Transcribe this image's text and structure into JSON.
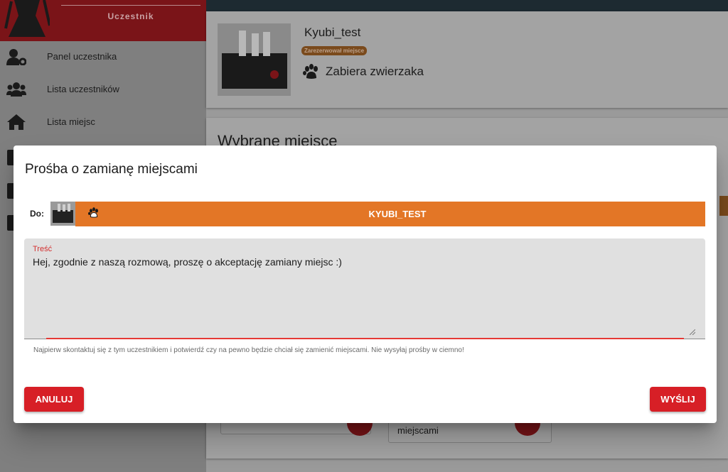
{
  "sidebar": {
    "role": "Uczestnik",
    "items": [
      {
        "label": "Panel uczestnika",
        "icon": "user-gear-icon"
      },
      {
        "label": "Lista uczestników",
        "icon": "users-icon"
      },
      {
        "label": "Lista miejsc",
        "icon": "home-icon"
      }
    ]
  },
  "participant": {
    "name": "Kyubi_test",
    "badge": "Zarezerwował miejsce",
    "pet": "Zabiera zwierzaka"
  },
  "chosen": {
    "title": "Wybrane miejsce",
    "field_text": "miejscami"
  },
  "modal": {
    "title": "Prośba o zamianę miejscami",
    "to_label": "Do:",
    "recipient": "KYUBI_TEST",
    "message_label": "Treść",
    "message_value": "Hej, zgodnie z naszą rozmową, proszę o akceptację zamiany miejsc :)",
    "hint": "Najpierw skontaktuj się z tym uczestnikiem i potwierdź czy na pewno będzie chciał się zamienić miejscami. Nie wysyłaj prośby w ciemno!",
    "cancel_label": "ANULUJ",
    "send_label": "WYŚLIJ"
  },
  "colors": {
    "accent_red": "#d71f26",
    "accent_orange": "#e37626",
    "topbar": "#1d2a31"
  }
}
